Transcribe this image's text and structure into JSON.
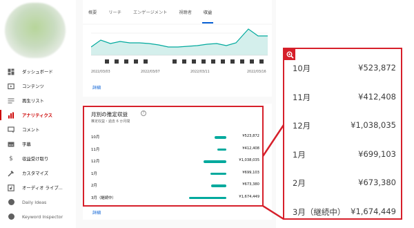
{
  "sidebar": {
    "items": [
      {
        "label": "ダッシュボード",
        "icon": "dashboard-icon",
        "active": false
      },
      {
        "label": "コンテンツ",
        "icon": "content-icon",
        "active": false
      },
      {
        "label": "再生リスト",
        "icon": "playlist-icon",
        "active": false
      },
      {
        "label": "アナリティクス",
        "icon": "analytics-icon",
        "active": true
      },
      {
        "label": "コメント",
        "icon": "comment-icon",
        "active": false
      },
      {
        "label": "字幕",
        "icon": "subtitles-icon",
        "active": false
      },
      {
        "label": "収益受け取り",
        "icon": "dollar-icon",
        "active": false
      },
      {
        "label": "カスタマイズ",
        "icon": "customize-icon",
        "active": false
      },
      {
        "label": "オーディオ ライブ...",
        "icon": "audio-library-icon",
        "active": false
      },
      {
        "label": "Daily Ideas",
        "icon": "extension-icon",
        "active": false
      },
      {
        "label": "Keyword Inspector",
        "icon": "extension-icon",
        "active": false
      }
    ]
  },
  "tabs": [
    {
      "label": "概要",
      "active": false
    },
    {
      "label": "リーチ",
      "active": false
    },
    {
      "label": "エンゲージメント",
      "active": false
    },
    {
      "label": "視聴者",
      "active": false
    },
    {
      "label": "収益",
      "active": true
    }
  ],
  "chart": {
    "x_labels": [
      "2022/03/03",
      "2022/03/07",
      "2022/03/11",
      "2022/03/16"
    ],
    "detail_link": "詳細",
    "accent": "#00a99d"
  },
  "revenue": {
    "title": "月別の推定収益",
    "subtitle": "推定収益・過去 6 か月間",
    "detail_link": "詳細",
    "rows": [
      {
        "month": "10月",
        "value": "¥523,872",
        "amount": 523872
      },
      {
        "month": "11月",
        "value": "¥412,408",
        "amount": 412408
      },
      {
        "month": "12月",
        "value": "¥1,038,035",
        "amount": 1038035
      },
      {
        "month": "1月",
        "value": "¥699,103",
        "amount": 699103
      },
      {
        "month": "2月",
        "value": "¥673,380",
        "amount": 673380
      },
      {
        "month": "3月（継続中）",
        "value": "¥1,674,449",
        "amount": 1674449
      }
    ],
    "bar_color": "#00a99d"
  },
  "zoom": {
    "icon": "zoom-in-icon",
    "rows": [
      {
        "month": "10月",
        "value": "¥523,872"
      },
      {
        "month": "11月",
        "value": "¥412,408"
      },
      {
        "month": "12月",
        "value": "¥1,038,035"
      },
      {
        "month": "1月",
        "value": "¥699,103"
      },
      {
        "month": "2月",
        "value": "¥673,380"
      },
      {
        "month": "3月（継続中）",
        "value": "¥1,674,449"
      }
    ]
  },
  "highlight_color": "#d61f2a"
}
